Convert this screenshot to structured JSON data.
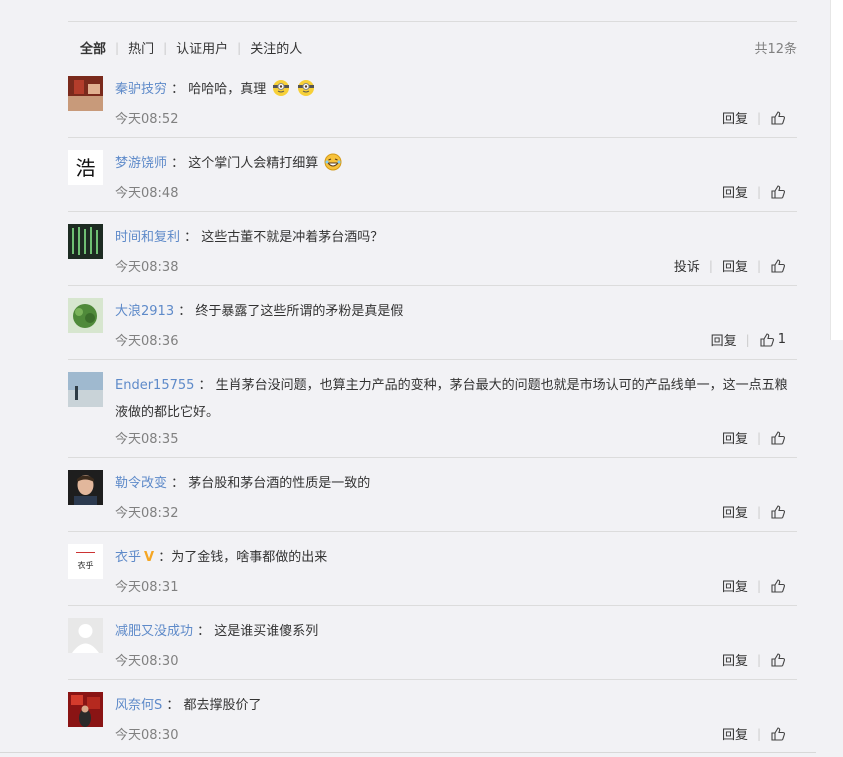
{
  "tabs": {
    "all": "全部",
    "hot": "热门",
    "verified": "认证用户",
    "following": "关注的人"
  },
  "count": "共12条",
  "actions": {
    "reply": "回复",
    "report": "投诉"
  },
  "icons": {
    "like": "thumbs-up-icon"
  },
  "colors": {
    "username": "#5e8ac9",
    "time": "#808080",
    "badge": "#f5a623"
  },
  "comments": [
    {
      "user": "秦驴技穷",
      "text": "哈哈哈，真理",
      "time": "今天08:52"
    },
    {
      "user": "梦游饶师",
      "text": "这个掌门人会精打细算",
      "time": "今天08:48"
    },
    {
      "user": "时间和复利",
      "text": "这些古董不就是冲着茅台酒吗？",
      "time": "今天08:38"
    },
    {
      "user": "大浪2913",
      "text": "终于暴露了这些所谓的矛粉是真是假",
      "time": "今天08:36",
      "likes": "1"
    },
    {
      "user": "Ender15755",
      "text": "生肖茅台没问题，也算主力产品的变种，茅台最大的问题也就是市场认可的产品线单一，这一点五粮液做的都比它好。",
      "time": "今天08:35"
    },
    {
      "user": "勒令改变",
      "text": "茅台股和茅台酒的性质是一致的",
      "time": "今天08:32"
    },
    {
      "user": "衣乎",
      "text": "为了金钱，啥事都做的出来",
      "time": "今天08:31",
      "avatar_text": "衣乎"
    },
    {
      "user": "减肥又没成功",
      "text": "这是谁买谁傻系列",
      "time": "今天08:30"
    },
    {
      "user": "风奈何S",
      "text": "都去撑股价了",
      "time": "今天08:30"
    }
  ]
}
